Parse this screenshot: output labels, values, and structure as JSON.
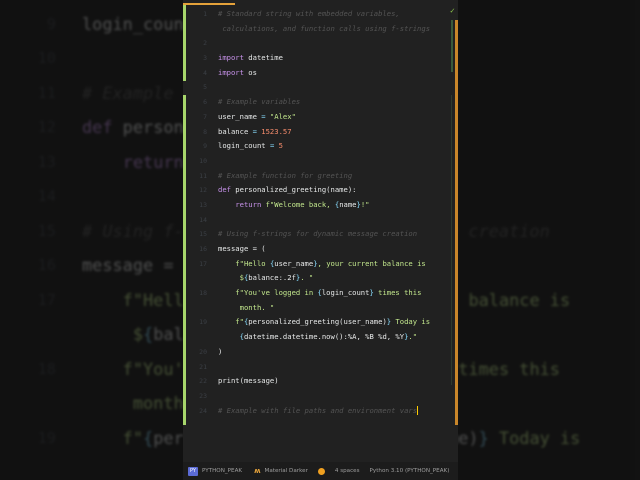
{
  "editor": {
    "rows": [
      {
        "ln": "1",
        "tokens": [
          [
            "comment",
            "# Standard string with embedded variables,"
          ]
        ]
      },
      {
        "ln": "",
        "tokens": [
          [
            "comment",
            " calculations, and function calls using f-strings"
          ]
        ]
      },
      {
        "ln": "2",
        "tokens": []
      },
      {
        "ln": "3",
        "tokens": [
          [
            "kw",
            "import"
          ],
          [
            "plain",
            " datetime"
          ]
        ]
      },
      {
        "ln": "4",
        "tokens": [
          [
            "kw",
            "import"
          ],
          [
            "plain",
            " os"
          ]
        ]
      },
      {
        "ln": "5",
        "tokens": []
      },
      {
        "ln": "6",
        "tokens": [
          [
            "comment",
            "# Example variables"
          ]
        ]
      },
      {
        "ln": "7",
        "tokens": [
          [
            "plain",
            "user_name "
          ],
          [
            "op",
            "="
          ],
          [
            "str",
            " \"Alex\""
          ]
        ]
      },
      {
        "ln": "8",
        "tokens": [
          [
            "plain",
            "balance "
          ],
          [
            "op",
            "="
          ],
          [
            "num",
            " 1523.57"
          ]
        ]
      },
      {
        "ln": "9",
        "tokens": [
          [
            "plain",
            "login_count "
          ],
          [
            "op",
            "="
          ],
          [
            "num",
            " 5"
          ]
        ]
      },
      {
        "ln": "10",
        "tokens": []
      },
      {
        "ln": "11",
        "tokens": [
          [
            "comment",
            "# Example function for greeting"
          ]
        ]
      },
      {
        "ln": "12",
        "tokens": [
          [
            "kw",
            "def"
          ],
          [
            "plain",
            " personalized_greeting(name):"
          ]
        ]
      },
      {
        "ln": "13",
        "tokens": [
          [
            "plain",
            "    "
          ],
          [
            "kw",
            "return"
          ],
          [
            "str",
            " f\"Welcome back, "
          ],
          [
            "brace",
            "{"
          ],
          [
            "plain",
            "name"
          ],
          [
            "brace",
            "}"
          ],
          [
            "str",
            "!\""
          ]
        ]
      },
      {
        "ln": "14",
        "tokens": []
      },
      {
        "ln": "15",
        "tokens": [
          [
            "comment",
            "# Using f-strings for dynamic message creation"
          ]
        ]
      },
      {
        "ln": "16",
        "tokens": [
          [
            "plain",
            "message = ("
          ]
        ]
      },
      {
        "ln": "17",
        "tokens": [
          [
            "str",
            "    f\"Hello "
          ],
          [
            "brace",
            "{"
          ],
          [
            "plain",
            "user_name"
          ],
          [
            "brace",
            "}"
          ],
          [
            "str",
            ", your current balance is"
          ]
        ]
      },
      {
        "ln": "",
        "tokens": [
          [
            "str",
            "     $"
          ],
          [
            "brace",
            "{"
          ],
          [
            "plain",
            "balance:.2f"
          ],
          [
            "brace",
            "}"
          ],
          [
            "str",
            ". \""
          ]
        ]
      },
      {
        "ln": "18",
        "tokens": [
          [
            "str",
            "    f\"You've logged in "
          ],
          [
            "brace",
            "{"
          ],
          [
            "plain",
            "login_count"
          ],
          [
            "brace",
            "}"
          ],
          [
            "str",
            " times this"
          ]
        ]
      },
      {
        "ln": "",
        "tokens": [
          [
            "str",
            "     month. \""
          ]
        ]
      },
      {
        "ln": "19",
        "tokens": [
          [
            "str",
            "    f\""
          ],
          [
            "brace",
            "{"
          ],
          [
            "plain",
            "personalized_greeting(user_name)"
          ],
          [
            "brace",
            "}"
          ],
          [
            "str",
            " Today is"
          ]
        ]
      },
      {
        "ln": "",
        "tokens": [
          [
            "str",
            "     "
          ],
          [
            "brace",
            "{"
          ],
          [
            "plain",
            "datetime.datetime.now():%A, %B %d, %Y"
          ],
          [
            "brace",
            "}"
          ],
          [
            "str",
            ".\""
          ]
        ]
      },
      {
        "ln": "20",
        "tokens": [
          [
            "plain",
            ")"
          ]
        ]
      },
      {
        "ln": "21",
        "tokens": []
      },
      {
        "ln": "22",
        "tokens": [
          [
            "plain",
            "print(message)"
          ]
        ]
      },
      {
        "ln": "23",
        "tokens": []
      },
      {
        "ln": "24",
        "tokens": [
          [
            "comment",
            "# Example with file paths and environment vars"
          ]
        ],
        "cursor": true
      }
    ]
  },
  "status_bar": {
    "py_icon": "PY",
    "project": "PYTHON_PEAK",
    "theme": "Material Darker",
    "indent": "4 spaces",
    "interpreter": "Python 3.10 (PYTHON_PEAK)"
  },
  "colors": {
    "accent": "#e5a23a",
    "gutter_changed": "#a7d66b",
    "keyword": "#c792ea",
    "string": "#c3e88d",
    "number": "#f78c6c"
  }
}
